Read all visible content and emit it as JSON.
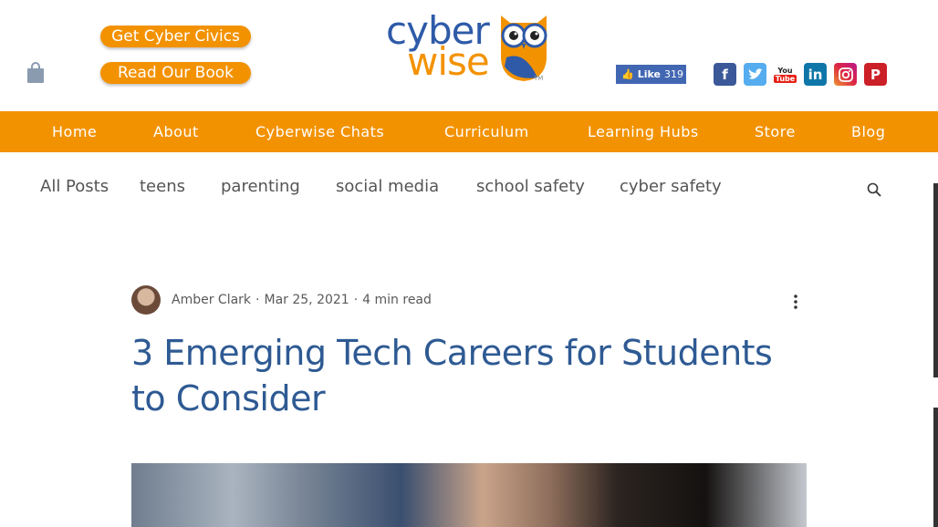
{
  "header": {
    "cta_1": "Get Cyber Civics",
    "cta_2": "Read Our Book",
    "logo": {
      "line1": "cyber",
      "line2": "wise",
      "tm": "TM"
    },
    "fb_like": {
      "label": "Like",
      "count": "319"
    },
    "social": [
      {
        "name": "facebook-icon",
        "glyph": "f",
        "color": "#3b5998"
      },
      {
        "name": "twitter-icon",
        "glyph": "t",
        "color": "#55acee"
      },
      {
        "name": "youtube-icon",
        "glyph": "You",
        "color": "#ffffff"
      },
      {
        "name": "linkedin-icon",
        "glyph": "in",
        "color": "#0e76a8"
      },
      {
        "name": "instagram-icon",
        "glyph": "◎",
        "color": "#c13584"
      },
      {
        "name": "pinterest-icon",
        "glyph": "P",
        "color": "#cb2027"
      }
    ]
  },
  "nav": {
    "items": [
      "Home",
      "About",
      "Cyberwise Chats",
      "Curriculum",
      "Learning Hubs",
      "Store",
      "Blog"
    ]
  },
  "categories": [
    "All Posts",
    "teens",
    "parenting",
    "social media",
    "school safety",
    "cyber safety"
  ],
  "post": {
    "author": "Amber Clark",
    "date": "Mar 25, 2021",
    "read_time": "4 min read",
    "title": "3 Emerging Tech Careers for Students to Consider"
  },
  "colors": {
    "accent": "#f39200",
    "title": "#2e5a93",
    "logo_blue": "#2e5aa8"
  }
}
